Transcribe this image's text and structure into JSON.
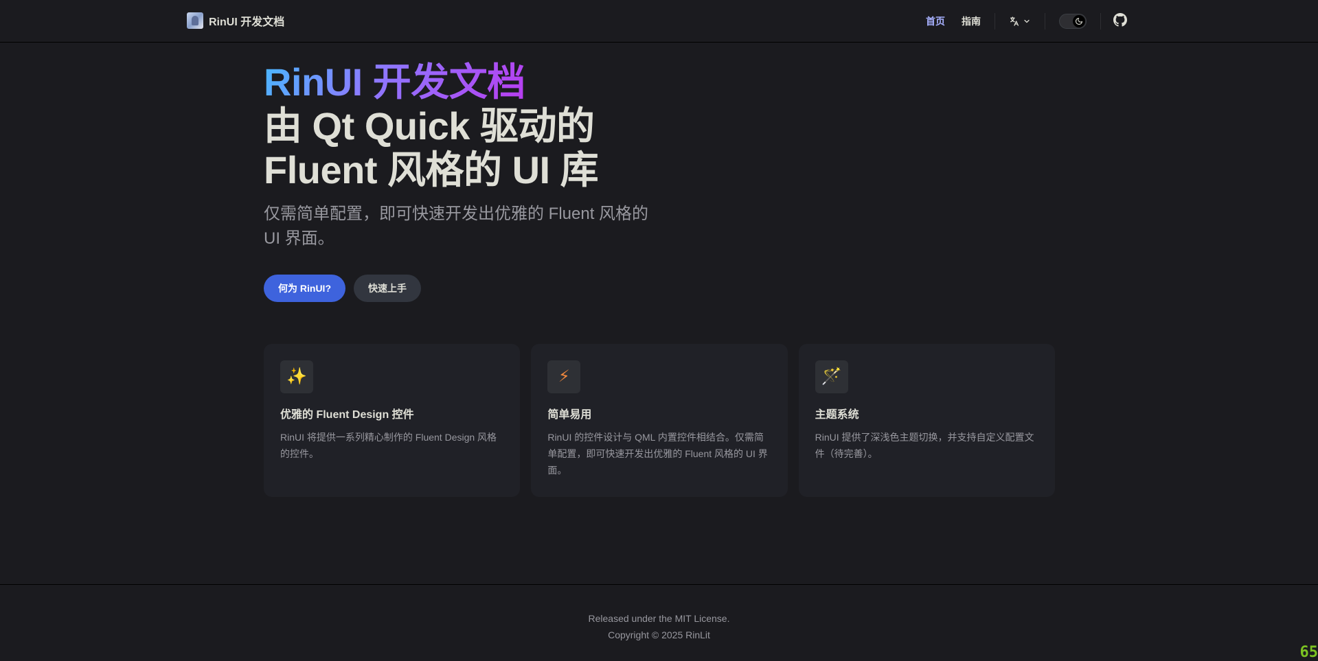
{
  "nav": {
    "brand_title": "RinUI 开发文档",
    "links": [
      {
        "label": "首页",
        "active": true
      },
      {
        "label": "指南",
        "active": false
      }
    ],
    "language_icon": "translate-icon",
    "theme_toggle_icon": "moon-icon",
    "github_icon": "github-icon"
  },
  "hero": {
    "name": "RinUI 开发文档",
    "text_line1": "由 Qt Quick 驱动的",
    "text_line2": "Fluent 风格的 UI 库",
    "tagline": "仅需简单配置，即可快速开发出优雅的 Fluent 风格的 UI 界面。",
    "actions": [
      {
        "label": "何为 RinUI?",
        "theme": "brand"
      },
      {
        "label": "快速上手",
        "theme": "alt"
      }
    ]
  },
  "features": [
    {
      "icon": "✨",
      "icon_name": "sparkles-icon",
      "title": "优雅的 Fluent Design 控件",
      "details": "RinUI 将提供一系列精心制作的 Fluent Design 风格的控件。"
    },
    {
      "icon": "⚡",
      "icon_name": "lightning-icon",
      "title": "简单易用",
      "details": "RinUI 的控件设计与 QML 内置控件相结合。仅需简单配置，即可快速开发出优雅的 Fluent 风格的 UI 界面。"
    },
    {
      "icon": "🪄",
      "icon_name": "magic-wand-icon",
      "title": "主题系统",
      "details": "RinUI 提供了深浅色主题切换，并支持自定义配置文件（待完善）。"
    }
  ],
  "footer": {
    "message": "Released under the MIT License.",
    "copyright": "Copyright © 2025 RinLit"
  },
  "corner_badge": "65",
  "colors": {
    "background": "#1b1b1f",
    "brand": "#3e63dd",
    "active_link": "#a8b1ff",
    "text": "#dfdfd6",
    "muted_text": "#98989f"
  }
}
